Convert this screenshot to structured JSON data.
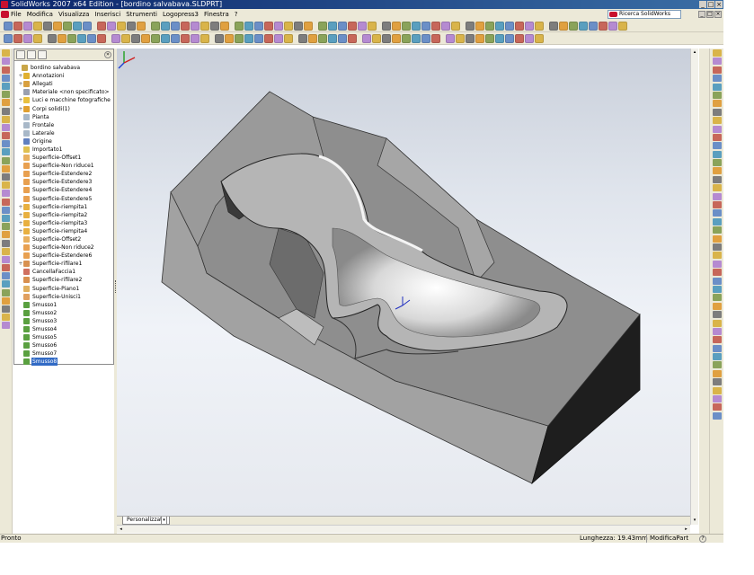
{
  "window": {
    "title": "SolidWorks 2007 x64 Edition - [bordino salvabava.SLDPRT]",
    "controls": [
      "_",
      "□",
      "×"
    ]
  },
  "menubar": {
    "items": [
      "File",
      "Modifica",
      "Visualizza",
      "Inserisci",
      "Strumenti",
      "Logopress3",
      "Finestra",
      "?"
    ],
    "search_placeholder": "Ricerca SolidWorks",
    "doc_controls": [
      "_",
      "□",
      "×"
    ]
  },
  "feature_manager": {
    "collapse_glyph": "»",
    "tree": [
      {
        "label": "bordino salvabava",
        "icon": "part-icon",
        "color": "#c9a648",
        "level": 0,
        "expander": ""
      },
      {
        "label": "Annotazioni",
        "icon": "annotations-icon",
        "color": "#e0b030",
        "level": 1,
        "expander": "+"
      },
      {
        "label": "Allegati",
        "icon": "attachments-icon",
        "color": "#d8a040",
        "level": 1,
        "expander": "+"
      },
      {
        "label": "Materiale <non specificato>",
        "icon": "material-icon",
        "color": "#9aa0b0",
        "level": 1,
        "expander": ""
      },
      {
        "label": "Luci e macchine fotografiche",
        "icon": "lights-icon",
        "color": "#e8c040",
        "level": 1,
        "expander": "+"
      },
      {
        "label": "Corpi solidi(1)",
        "icon": "solid-bodies-icon",
        "color": "#e0a030",
        "level": 1,
        "expander": "+"
      },
      {
        "label": "Pianta",
        "icon": "plane-icon",
        "color": "#a8b8c8",
        "level": 1,
        "expander": ""
      },
      {
        "label": "Frontale",
        "icon": "plane-icon",
        "color": "#a8b8c8",
        "level": 1,
        "expander": ""
      },
      {
        "label": "Laterale",
        "icon": "plane-icon",
        "color": "#a8b8c8",
        "level": 1,
        "expander": ""
      },
      {
        "label": "Origine",
        "icon": "origin-icon",
        "color": "#6080c0",
        "level": 1,
        "expander": ""
      },
      {
        "label": "Importato1",
        "icon": "imported-icon",
        "color": "#e0c050",
        "level": 1,
        "expander": ""
      },
      {
        "label": "Superficie-Offset1",
        "icon": "surface-offset-icon",
        "color": "#e8b060",
        "level": 1,
        "expander": ""
      },
      {
        "label": "Superficie-Non riduce1",
        "icon": "surface-untrim-icon",
        "color": "#e8a050",
        "level": 1,
        "expander": ""
      },
      {
        "label": "Superficie-Estendere2",
        "icon": "surface-extend-icon",
        "color": "#e8a050",
        "level": 1,
        "expander": ""
      },
      {
        "label": "Superficie-Estendere3",
        "icon": "surface-extend-icon",
        "color": "#e8a050",
        "level": 1,
        "expander": ""
      },
      {
        "label": "Superficie-Estendere4",
        "icon": "surface-extend-icon",
        "color": "#e8a050",
        "level": 1,
        "expander": ""
      },
      {
        "label": "Superficie-Estendere5",
        "icon": "surface-extend-icon",
        "color": "#e8a050",
        "level": 1,
        "expander": ""
      },
      {
        "label": "Superficie-riempita1",
        "icon": "surface-fill-icon",
        "color": "#e8b040",
        "level": 1,
        "expander": "+"
      },
      {
        "label": "Superficie-riempita2",
        "icon": "surface-fill-icon",
        "color": "#e8b040",
        "level": 1,
        "expander": "+"
      },
      {
        "label": "Superficie-riempita3",
        "icon": "surface-fill-icon",
        "color": "#e8b040",
        "level": 1,
        "expander": "+"
      },
      {
        "label": "Superficie-riempita4",
        "icon": "surface-fill-icon",
        "color": "#e8b040",
        "level": 1,
        "expander": "+"
      },
      {
        "label": "Superficie-Offset2",
        "icon": "surface-offset-icon",
        "color": "#e8b060",
        "level": 1,
        "expander": ""
      },
      {
        "label": "Superficie-Non riduce2",
        "icon": "surface-untrim-icon",
        "color": "#e8a050",
        "level": 1,
        "expander": ""
      },
      {
        "label": "Superficie-Estendere6",
        "icon": "surface-extend-icon",
        "color": "#e8a050",
        "level": 1,
        "expander": ""
      },
      {
        "label": "Superficie-rifilare1",
        "icon": "surface-trim-icon",
        "color": "#d89050",
        "level": 1,
        "expander": "+"
      },
      {
        "label": "CancellaFaccia1",
        "icon": "delete-face-icon",
        "color": "#d07060",
        "level": 1,
        "expander": ""
      },
      {
        "label": "Superficie-rifilare2",
        "icon": "surface-trim-icon",
        "color": "#d89050",
        "level": 1,
        "expander": ""
      },
      {
        "label": "Superficie-Piano1",
        "icon": "planar-surface-icon",
        "color": "#e0b060",
        "level": 1,
        "expander": ""
      },
      {
        "label": "Superficie-Unisci1",
        "icon": "knit-surface-icon",
        "color": "#e0a060",
        "level": 1,
        "expander": ""
      },
      {
        "label": "Smusso1",
        "icon": "fillet-icon",
        "color": "#5aa040",
        "level": 1,
        "expander": ""
      },
      {
        "label": "Smusso2",
        "icon": "fillet-icon",
        "color": "#5aa040",
        "level": 1,
        "expander": ""
      },
      {
        "label": "Smusso3",
        "icon": "fillet-icon",
        "color": "#5aa040",
        "level": 1,
        "expander": ""
      },
      {
        "label": "Smusso4",
        "icon": "fillet-icon",
        "color": "#5aa040",
        "level": 1,
        "expander": ""
      },
      {
        "label": "Smusso5",
        "icon": "fillet-icon",
        "color": "#5aa040",
        "level": 1,
        "expander": ""
      },
      {
        "label": "Smusso6",
        "icon": "fillet-icon",
        "color": "#5aa040",
        "level": 1,
        "expander": ""
      },
      {
        "label": "Smusso7",
        "icon": "fillet-icon",
        "color": "#5aa040",
        "level": 1,
        "expander": ""
      },
      {
        "label": "Smusso8",
        "icon": "fillet-icon",
        "color": "#5aa040",
        "level": 1,
        "expander": "",
        "selected": true
      }
    ]
  },
  "view_tabs": {
    "active": "Personalizzato",
    "arrow": "▾"
  },
  "scrollbars": {
    "left_arrow": "◂",
    "right_arrow": "▸",
    "up_arrow": "▴",
    "down_arrow": "▾"
  },
  "statusbar": {
    "status": "Pronto",
    "measurement": "Lunghezza: 19.43mm",
    "mode": "ModificaPart",
    "help": "?"
  },
  "colors": {
    "title_bar": "#0a246a",
    "selection": "#316ac5",
    "model_gray": "#8c8c8c",
    "chrome": "#ece9d8"
  }
}
